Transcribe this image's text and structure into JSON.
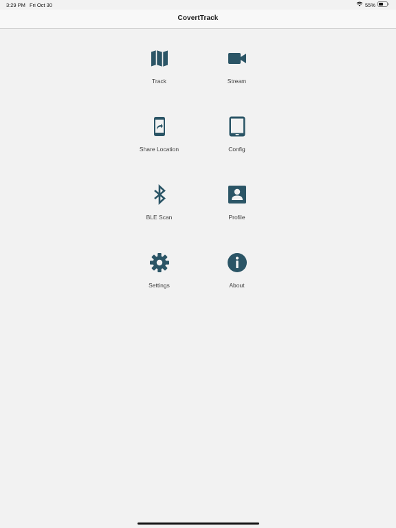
{
  "status_bar": {
    "time": "3:29 PM",
    "date": "Fri Oct 30",
    "battery": "55%",
    "battery_level": 0.55,
    "wifi_icon": "wifi-icon",
    "battery_icon": "battery-icon"
  },
  "navbar": {
    "title": "CovertTrack"
  },
  "colors": {
    "accent": "#2b5566",
    "background": "#f2f2f2"
  },
  "menu": [
    {
      "label": "Track",
      "icon": "map-icon"
    },
    {
      "label": "Stream",
      "icon": "video-camera-icon"
    },
    {
      "label": "Share Location",
      "icon": "share-phone-icon"
    },
    {
      "label": "Config",
      "icon": "tablet-icon"
    },
    {
      "label": "BLE Scan",
      "icon": "bluetooth-icon"
    },
    {
      "label": "Profile",
      "icon": "profile-card-icon"
    },
    {
      "label": "Settings",
      "icon": "gear-icon"
    },
    {
      "label": "About",
      "icon": "info-icon"
    }
  ]
}
